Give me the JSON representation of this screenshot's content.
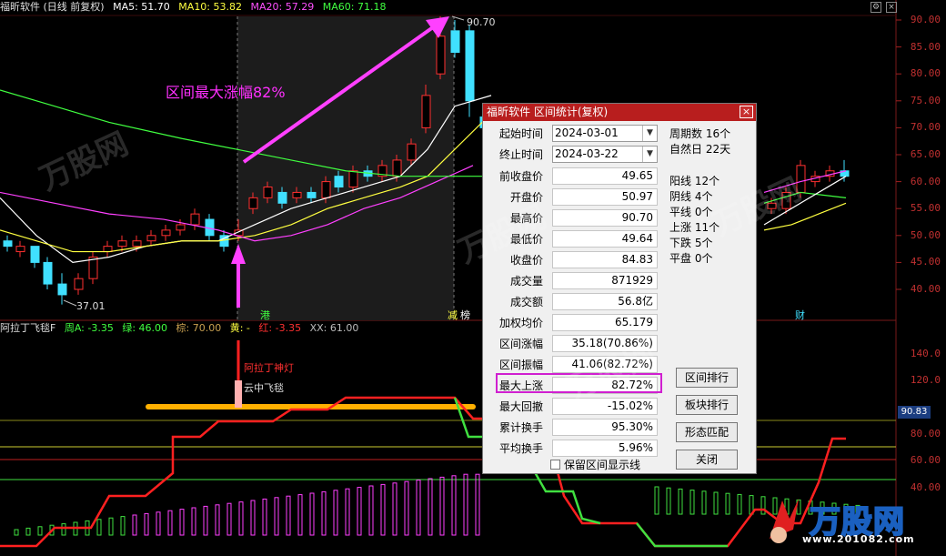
{
  "header": {
    "title": "福昕软件 (日线 前复权)",
    "ma5": "MA5: 51.70",
    "ma10": "MA10: 53.82",
    "ma20": "MA20: 57.29",
    "ma60": "MA60: 71.18"
  },
  "indicator_header": {
    "name": "阿拉丁飞毯F",
    "zhou": "周A: -3.35",
    "lv": "绿: 46.00",
    "zong": "棕: 70.00",
    "huang": "黄: -",
    "hong": "红: -3.35",
    "xx": "XX: 61.00"
  },
  "price_axis": [
    "90.00",
    "85.00",
    "80.00",
    "75.00",
    "70.00",
    "65.00",
    "60.00",
    "55.00",
    "50.00",
    "45.00",
    "40.00"
  ],
  "indicator_axis": [
    "140.0",
    "120.0",
    "80.00",
    "60.00",
    "40.00"
  ],
  "current_price_tag": "90.83",
  "annotations": {
    "max_rise": "区间最大涨幅82%",
    "low_label": "37.01",
    "high_label": "90.70",
    "signal1": "阿拉丁神灯",
    "signal2": "云中飞毯",
    "tag_gang": "港",
    "tag_jianchi": "减",
    "tag_bang": "榜",
    "tag_cai": "财"
  },
  "colors": {
    "up": "#ff3030",
    "down": "#40e0ff",
    "ma5": "#ffffff",
    "ma10": "#ffff40",
    "ma20": "#ff40ff",
    "ma60": "#40ff40",
    "dialog_title": "#b81e1e",
    "highlight": "#d01fd0"
  },
  "dialog": {
    "title": "福昕软件 区间统计(复权)",
    "close": "×",
    "start_label": "起始时间",
    "start_value": "2024-03-01",
    "end_label": "终止时间",
    "end_value": "2024-03-22",
    "rows": [
      {
        "k": "前收盘价",
        "v": "49.65"
      },
      {
        "k": "开盘价",
        "v": "50.97"
      },
      {
        "k": "最高价",
        "v": "90.70"
      },
      {
        "k": "最低价",
        "v": "49.64"
      },
      {
        "k": "收盘价",
        "v": "84.83"
      },
      {
        "k": "成交量",
        "v": "871929"
      },
      {
        "k": "成交额",
        "v": "56.8亿"
      },
      {
        "k": "加权均价",
        "v": "65.179"
      },
      {
        "k": "区间涨幅",
        "v": "35.18(70.86%)"
      },
      {
        "k": "区间振幅",
        "v": "41.06(82.72%)"
      },
      {
        "k": "最大上涨",
        "v": "82.72%"
      },
      {
        "k": "最大回撤",
        "v": "-15.02%"
      },
      {
        "k": "累计换手",
        "v": "95.30%"
      },
      {
        "k": "平均换手",
        "v": "5.96%"
      }
    ],
    "stats": [
      "周期数 16个",
      "自然日 22天",
      "阳线 12个",
      "阴线 4个",
      "平线 0个",
      "上涨 11个",
      "下跌 5个",
      "平盘 0个"
    ],
    "buttons": [
      "区间排行",
      "板块排行",
      "形态匹配",
      "关闭"
    ],
    "checkbox_label": "保留区间显示线"
  },
  "watermark": {
    "big": "万股网",
    "small": "www.201082.com"
  }
}
